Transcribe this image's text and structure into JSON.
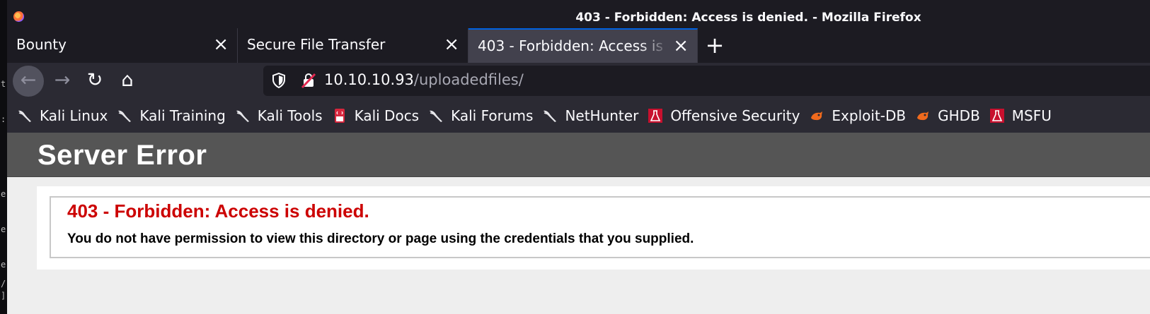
{
  "window": {
    "title": "403 - Forbidden: Access is denied. - Mozilla Firefox"
  },
  "tabs": [
    {
      "label": "Bounty",
      "active": false
    },
    {
      "label": "Secure File Transfer",
      "active": false
    },
    {
      "label": "403 - Forbidden: Access is denied.",
      "active": true
    }
  ],
  "icons": {
    "close": "×",
    "new_tab": "+",
    "back": "←",
    "forward": "→",
    "reload": "↻",
    "home": "⌂"
  },
  "urlbar": {
    "host": "10.10.10.93",
    "path": "/uploadedfiles/"
  },
  "bookmarks": [
    {
      "label": "Kali Linux",
      "icon": "kali-dragon-icon"
    },
    {
      "label": "Kali Training",
      "icon": "kali-dragon-icon"
    },
    {
      "label": "Kali Tools",
      "icon": "kali-dragon-icon"
    },
    {
      "label": "Kali Docs",
      "icon": "kali-docs-icon"
    },
    {
      "label": "Kali Forums",
      "icon": "kali-dragon-icon"
    },
    {
      "label": "NetHunter",
      "icon": "kali-dragon-icon"
    },
    {
      "label": "Offensive Security",
      "icon": "offsec-icon"
    },
    {
      "label": "Exploit-DB",
      "icon": "exploitdb-icon"
    },
    {
      "label": "GHDB",
      "icon": "exploitdb-icon"
    },
    {
      "label": "MSFU",
      "icon": "offsec-icon"
    }
  ],
  "page": {
    "header": "Server Error",
    "error_title": "403 - Forbidden: Access is denied.",
    "error_message": "You do not have permission to view this directory or page using the credentials that you supplied."
  },
  "colors": {
    "active_tab_accent": "#0061e0",
    "error_red": "#cc0000",
    "header_gray": "#555555"
  },
  "left_strip_chars": [
    "t",
    ":",
    "e",
    "e",
    "e",
    "/",
    "]"
  ]
}
